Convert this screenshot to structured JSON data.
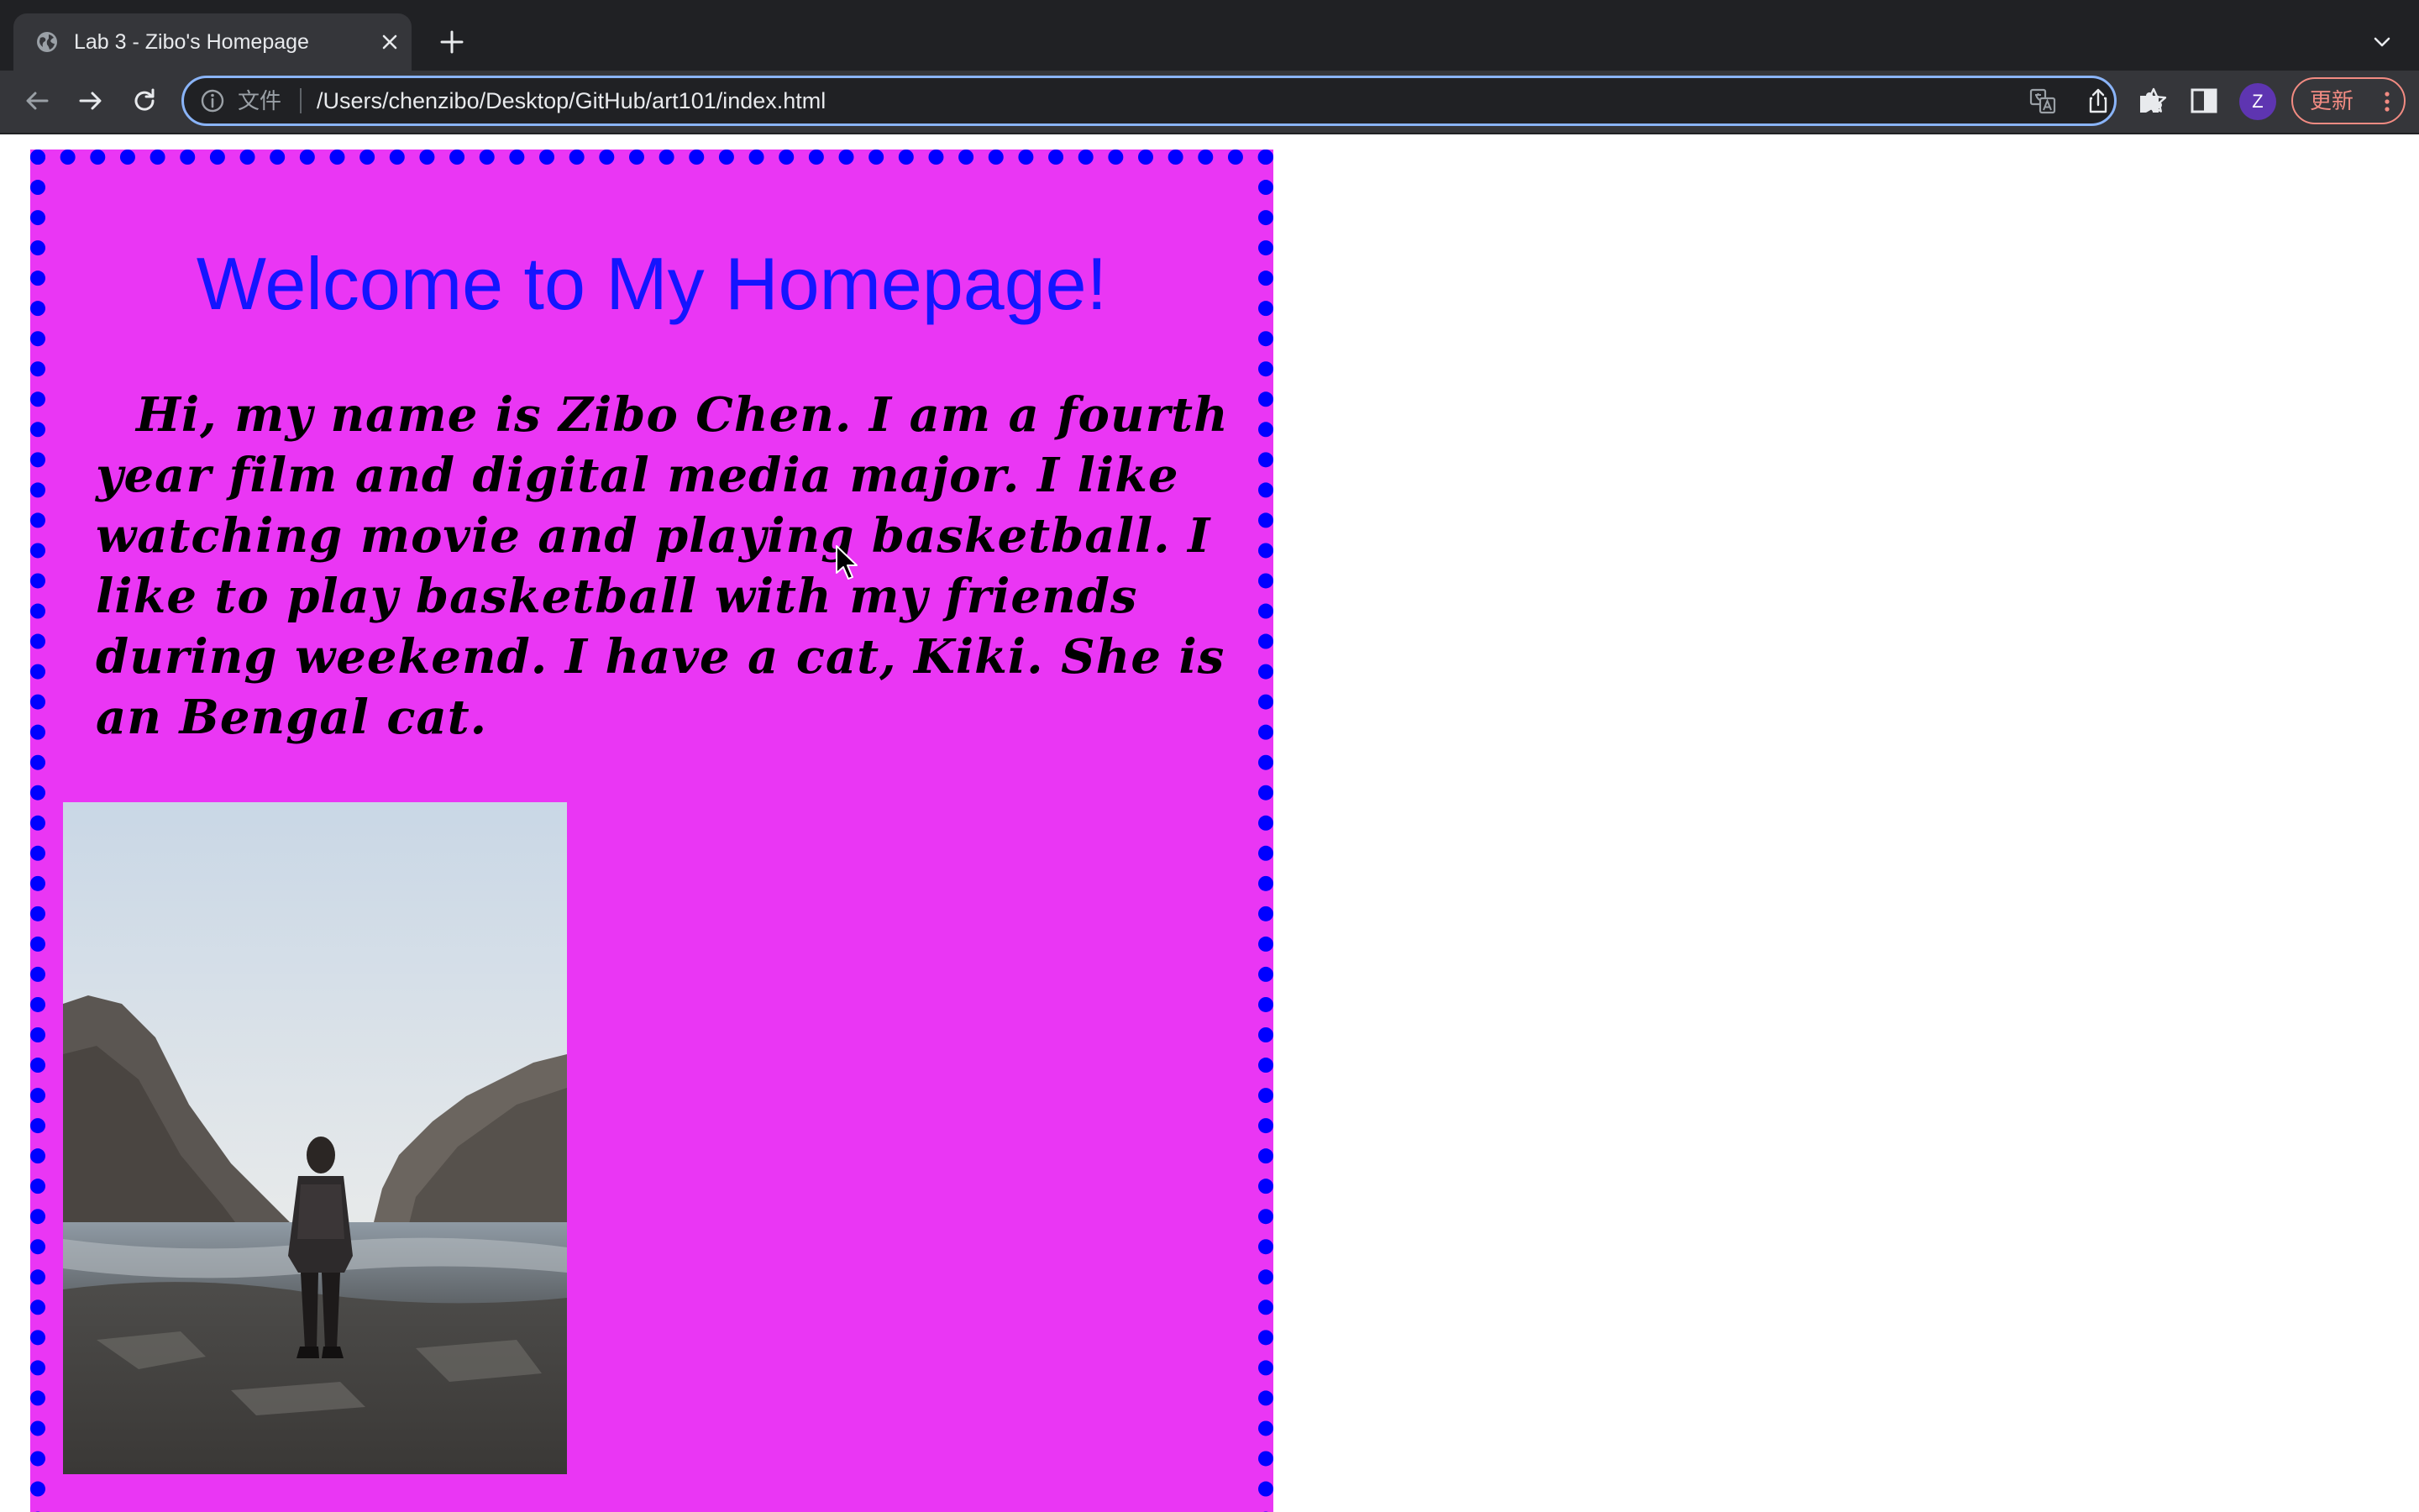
{
  "browser": {
    "tab": {
      "title": "Lab 3 - Zibo's Homepage"
    },
    "omnibox": {
      "scheme_label": "文件",
      "url": "/Users/chenzibo/Desktop/GitHub/art101/index.html"
    },
    "profile": {
      "initial": "Z"
    },
    "update_button": {
      "label": "更新"
    },
    "colors": {
      "tabstrip_bg": "#202124",
      "toolbar_bg": "#35363a",
      "omnibox_focus": "#8ab4f8",
      "update_accent": "#f28b82",
      "avatar_bg": "#5e35b1"
    },
    "icons": [
      "globe-icon",
      "close-icon",
      "plus-icon",
      "chevron-down-icon",
      "back-arrow-icon",
      "forward-arrow-icon",
      "reload-icon",
      "info-icon",
      "translate-icon",
      "share-icon",
      "star-icon",
      "puzzle-icon",
      "side-panel-icon",
      "more-vert-icon",
      "cursor-icon"
    ]
  },
  "page": {
    "heading": "Welcome to My Homepage!",
    "bio": "Hi, my name is Zibo Chen. I am a fourth year film and digital media major. I like watching movie and playing basketball. I like to play basketball with my friends during weekend. I have a cat, Kiki. She is an Bengal cat.",
    "colors": {
      "card_bg": "#ea36f4",
      "border": "#0000ff",
      "heading": "#1414ff",
      "text": "#000000"
    }
  }
}
